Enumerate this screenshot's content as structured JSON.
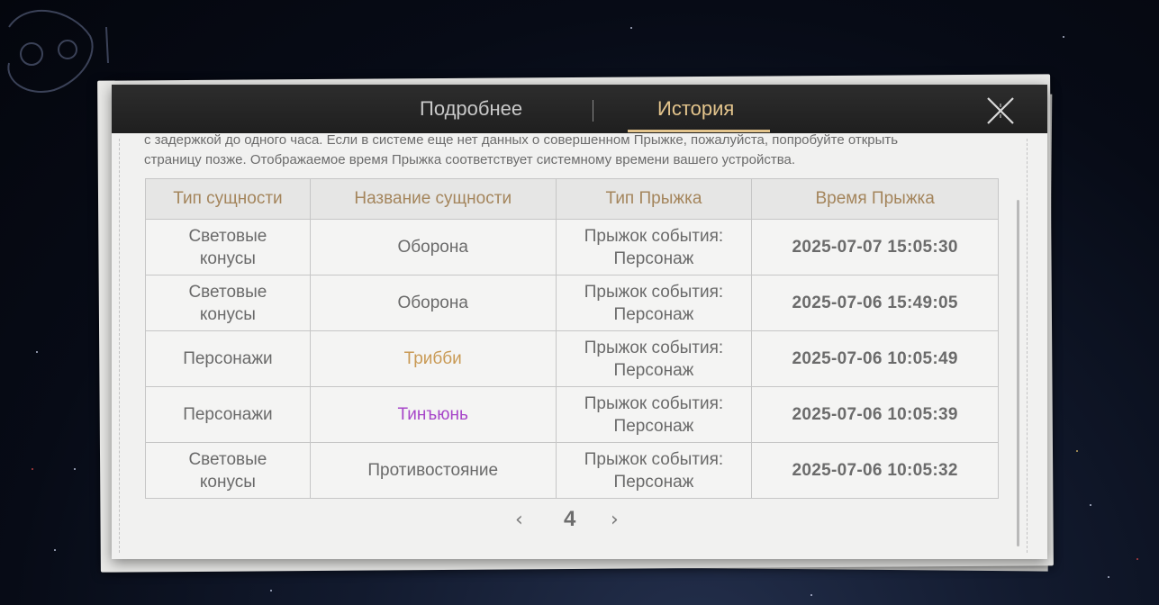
{
  "header": {
    "tabs": [
      {
        "label": "Подробнее",
        "active": false
      },
      {
        "label": "История",
        "active": true
      }
    ],
    "close_icon": "close-x-icon"
  },
  "notice": {
    "line1": "с задержкой до одного часа. Если в системе еще нет данных о совершенном Прыжке, пожалуйста, попробуйте открыть",
    "line2": "страницу позже. Отображаемое время Прыжка соответствует системному времени вашего устройства."
  },
  "table": {
    "headers": [
      "Тип сущности",
      "Название сущности",
      "Тип Прыжка",
      "Время Прыжка"
    ],
    "rows": [
      {
        "type": "Световые\nконусы",
        "name": "Оборона",
        "warp_type": "Прыжок события:\nПерсонаж",
        "time": "2025-07-07 15:05:30"
      },
      {
        "type": "Световые\nконусы",
        "name": "Оборона",
        "warp_type": "Прыжок события:\nПерсонаж",
        "time": "2025-07-06 15:49:05"
      },
      {
        "type": "Персонажи",
        "name": "Трибби",
        "warp_type": "Прыжок события:\nПерсонаж",
        "time": "2025-07-06 10:05:49"
      },
      {
        "type": "Персонажи",
        "name": "Тинъюнь",
        "warp_type": "Прыжок события:\nПерсонаж",
        "time": "2025-07-06 10:05:39"
      },
      {
        "type": "Световые\nконусы",
        "name": "Противостояние",
        "warp_type": "Прыжок события:\nПерсонаж",
        "time": "2025-07-06 10:05:32"
      }
    ]
  },
  "pager": {
    "prev": "‹",
    "page": "4",
    "next": "›"
  },
  "colors": {
    "accent_gold": "#e3c48c",
    "header_text_gold": "#a4855c",
    "four_star_gold": "#c99a55",
    "five_star_purple": "#a746c9"
  }
}
